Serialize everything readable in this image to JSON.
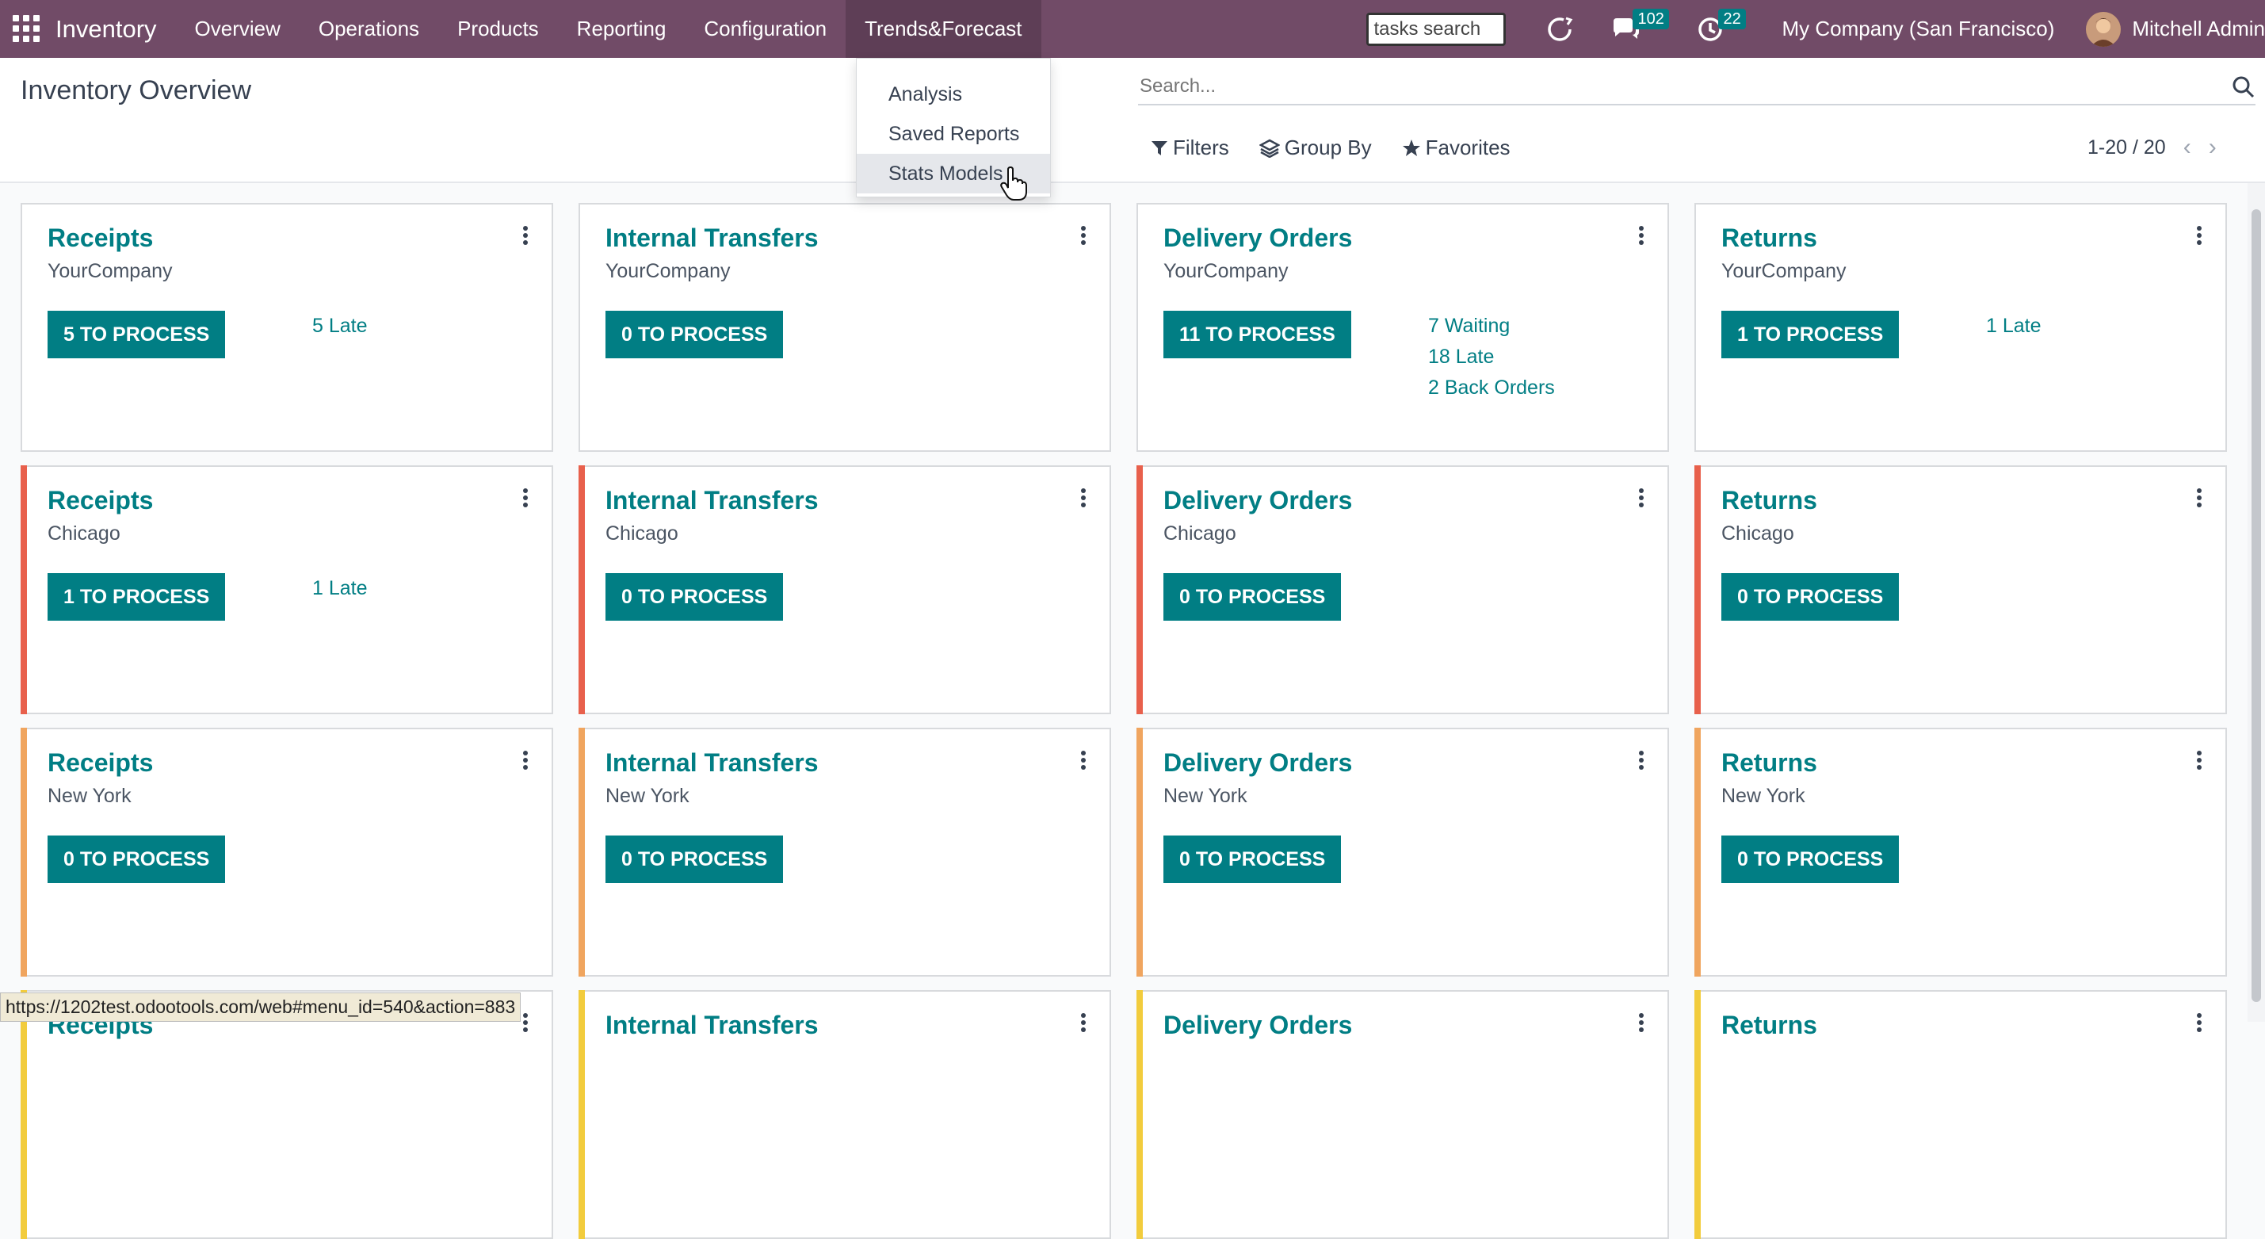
{
  "navbar": {
    "brand": "Inventory",
    "menu": [
      "Overview",
      "Operations",
      "Products",
      "Reporting",
      "Configuration",
      "Trends&Forecast"
    ],
    "tasks_search_value": "tasks search",
    "messages_badge": "102",
    "activities_badge": "22",
    "company": "My Company (San Francisco)",
    "user": "Mitchell Admin",
    "color": "#714b67"
  },
  "dropdown": {
    "items": [
      "Analysis",
      "Saved Reports",
      "Stats Models"
    ]
  },
  "control_panel": {
    "title": "Inventory Overview",
    "search_placeholder": "Search...",
    "filters_label": "Filters",
    "group_by_label": "Group By",
    "favorites_label": "Favorites",
    "pager": "1-20 / 20"
  },
  "cards": [
    {
      "title": "Receipts",
      "sub": "YourCompany",
      "button": "5 TO PROCESS",
      "stats": [
        "5 Late"
      ]
    },
    {
      "title": "Internal Transfers",
      "sub": "YourCompany",
      "button": "0 TO PROCESS",
      "stats": []
    },
    {
      "title": "Delivery Orders",
      "sub": "YourCompany",
      "button": "11 TO PROCESS",
      "stats": [
        "7 Waiting",
        "18 Late",
        "2 Back Orders"
      ]
    },
    {
      "title": "Returns",
      "sub": "YourCompany",
      "button": "1 TO PROCESS",
      "stats": [
        "1 Late"
      ]
    },
    {
      "title": "Receipts",
      "sub": "Chicago",
      "button": "1 TO PROCESS",
      "stats": [
        "1 Late"
      ]
    },
    {
      "title": "Internal Transfers",
      "sub": "Chicago",
      "button": "0 TO PROCESS",
      "stats": []
    },
    {
      "title": "Delivery Orders",
      "sub": "Chicago",
      "button": "0 TO PROCESS",
      "stats": []
    },
    {
      "title": "Returns",
      "sub": "Chicago",
      "button": "0 TO PROCESS",
      "stats": []
    },
    {
      "title": "Receipts",
      "sub": "New York",
      "button": "0 TO PROCESS",
      "stats": []
    },
    {
      "title": "Internal Transfers",
      "sub": "New York",
      "button": "0 TO PROCESS",
      "stats": []
    },
    {
      "title": "Delivery Orders",
      "sub": "New York",
      "button": "0 TO PROCESS",
      "stats": []
    },
    {
      "title": "Returns",
      "sub": "New York",
      "button": "0 TO PROCESS",
      "stats": []
    },
    {
      "title": "Receipts",
      "sub": "",
      "button": "",
      "stats": []
    },
    {
      "title": "Internal Transfers",
      "sub": "",
      "button": "",
      "stats": []
    },
    {
      "title": "Delivery Orders",
      "sub": "",
      "button": "",
      "stats": []
    },
    {
      "title": "Returns",
      "sub": "",
      "button": "",
      "stats": []
    }
  ],
  "row_colors": [
    "",
    "#e8604c",
    "#f0a55f",
    "#f2cc3d"
  ],
  "accent_color": "#017e84",
  "status_url": "https://1202test.odootools.com/web#menu_id=540&action=883"
}
